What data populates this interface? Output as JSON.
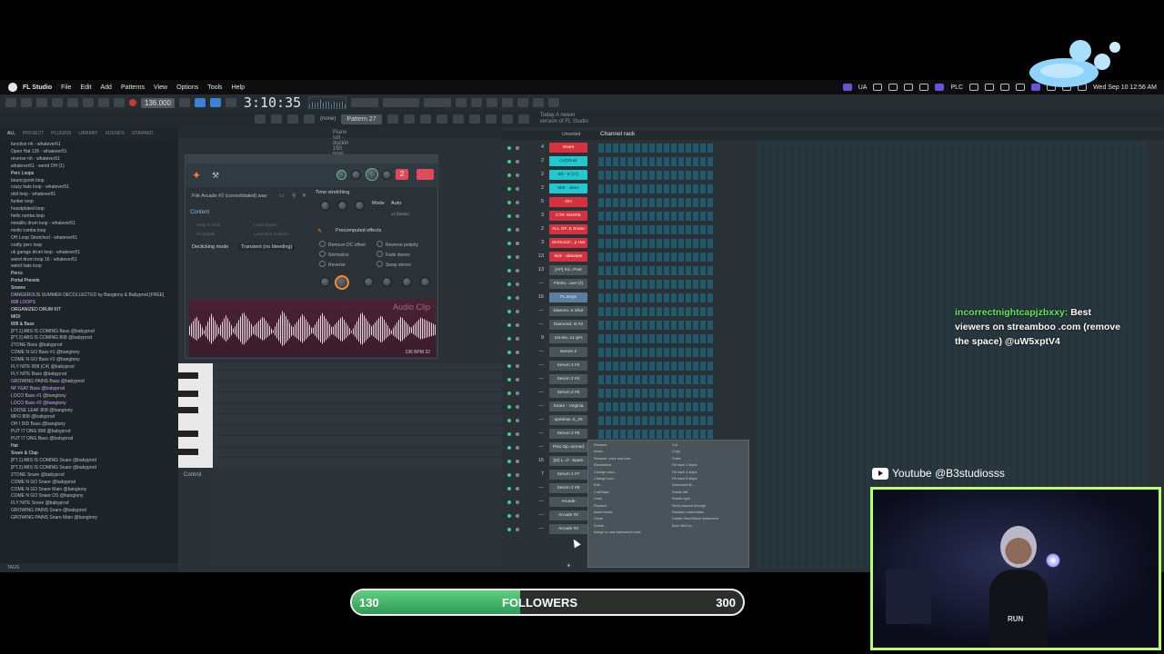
{
  "menubar": {
    "app_name": "FL Studio",
    "items": [
      "File",
      "Edit",
      "Add",
      "Patterns",
      "View",
      "Options",
      "Tools",
      "Help"
    ],
    "status_text_1": "UA",
    "status_text_2": "PLC",
    "datetime": "Wed Sep 10  12:56 AM"
  },
  "toolbar": {
    "bpm": "136.000",
    "song_time": "3:10:35",
    "pattern": "Pattern 27",
    "preset": "(none)",
    "hint_line1": "Today  A newer",
    "hint_line2": "version of FL Studio"
  },
  "browser": {
    "tabs": [
      "ALL",
      "PROJECT",
      "PLUGINS",
      "LIBRARY",
      "SOUNDS",
      "STARRED"
    ],
    "items": [
      "function nh - whatever51",
      "Open Hat 126 - whatever51",
      "reverse nh - whatever51",
      "whatever51 - weird OH (1)",
      "Perc Loops",
      "bouncypork loop",
      "crazy hats loop - whatever51",
      "dolt loop - whatever51",
      "funker loop",
      "hoastplated loop",
      "hello rumba loop",
      "metallic drum loop - whatever51",
      "mello rumba loop",
      "OH Loop Stretched - whatever51",
      "crafty perc loop",
      "uk garage drum loop - whatever51",
      "weird drum loop 16 - whatever51",
      "weird hats loop",
      "Percs",
      "Portal Presets",
      "Snares",
      "DANGEROUS SUMMER DECOLLECTED by Bangtony & Babyprod [FREE]",
      "808 LOOPS",
      "ORGANIZED DRUM KIT",
      "MIDI",
      "808 & Bass",
      "[PT.1] ABS IS COMING Bass @babyprod",
      "[PT.2] ABS IS COMING 808 @babyprod",
      "2TONE Bass @babyprod",
      "COME N GO Bass #1 @bangtony",
      "COME N GO Bass #2 @bangtony",
      "FLY NITE 808 (C4) @babyprod",
      "FLY NITE Bass @babyprod",
      "GROWING PAINS Bass @babyprod",
      "IM YEAT Bass @babyprod",
      "LOCO Bass #1 @bangtony",
      "LOCO Bass #2 @bangtony",
      "LOOSE LEAF 808 @bangtony",
      "MFO 808 @babyprod",
      "OH I DID Bass @bangtony",
      "PUT IT ONG 808 @babyprod",
      "PUT IT ONG Bass @babyprod",
      "Hat",
      "Snare & Clap",
      "[PT.1] ABS IS COMING Snare @babyprod",
      "[PT.2] ABS IS COMING Snare @babyprod",
      "2TONE Snare @babyprod",
      "COME N GO Snare @babyprod",
      "COME N GO Snare Main @bangtony",
      "COME N GO Snare OS @bangtony",
      "FLY NITE Snare @babyprod",
      "GROWING PAINS Snare @babyprod",
      "GROWING PAINS Snare Main @bangtony"
    ],
    "footer": "TAGS"
  },
  "playlist": {
    "header": "Piano roll - duckin 150 bpm @8 min @stevo",
    "control_label": "Control"
  },
  "audio_clip": {
    "file": "File  Arcade #2 (consolidated).wav",
    "counter": "2",
    "content_label": "Content",
    "content_opts": [
      "Keep on disk",
      "Resample",
      "Load regions",
      "Load slice markers"
    ],
    "declick_label": "Declicking mode",
    "declick_value": "Transient (no bleeding)",
    "time_stretching": "Time stretching",
    "mode_label": "Mode",
    "mode_value": "Auto",
    "beats": "x3 (beats)",
    "precomputed": "Precomputed effects",
    "effects_left": [
      "Remove DC offset",
      "Normalize",
      "Reverse"
    ],
    "effects_right": [
      "Reverse polarity",
      "Fade stereo",
      "Swap stereo"
    ],
    "wave_label": "Audio Clip",
    "wave_bpm": "136 BPM 32"
  },
  "channel_rack": {
    "unsorted": "Unsorted",
    "title": "Channel rack",
    "channels": [
      {
        "num": "4",
        "name": "Snare",
        "color": "red"
      },
      {
        "num": "2",
        "name": "(AZ)Drak",
        "color": "cyan"
      },
      {
        "num": "2",
        "name": "5B - 8 (27)",
        "color": "cyan"
      },
      {
        "num": "2",
        "name": "808 - Jleez",
        "color": "cyan"
      },
      {
        "num": "5",
        "name": "OH",
        "color": "red"
      },
      {
        "num": "3",
        "name": "CTR SNARE",
        "color": "red"
      },
      {
        "num": "2",
        "name": "ALL OF..E Snare",
        "color": "red"
      },
      {
        "num": "3",
        "name": "SHOULD'...p Hat",
        "color": "red"
      },
      {
        "num": "13",
        "name": "kick - absolute",
        "color": "red"
      },
      {
        "num": "13",
        "name": "[AP] Kic..Post",
        "color": "gray"
      },
      {
        "num": "---",
        "name": "Flintro...ave (2)",
        "color": "gray"
      },
      {
        "num": "16",
        "name": "FL Keys",
        "color": "blue"
      },
      {
        "num": "---",
        "name": "Diamon..e Shot",
        "color": "gray"
      },
      {
        "num": "---",
        "name": "Diamond..st #2",
        "color": "gray"
      },
      {
        "num": "9",
        "name": "1st-sto..n1-g%",
        "color": "gray"
      },
      {
        "num": "---",
        "name": "Serum 2",
        "color": "gray"
      },
      {
        "num": "---",
        "name": "Serum 2 #2",
        "color": "gray"
      },
      {
        "num": "---",
        "name": "Serum 2 #4",
        "color": "gray"
      },
      {
        "num": "---",
        "name": "Serum 2 #5",
        "color": "gray"
      },
      {
        "num": "---",
        "name": "Snare - Virginia",
        "color": "gray"
      },
      {
        "num": "---",
        "name": "openhat..rt_20",
        "color": "gray"
      },
      {
        "num": "---",
        "name": "Serum 2 #6",
        "color": "gray"
      },
      {
        "num": "---",
        "name": "Piss Op..nemed",
        "color": "gray"
      },
      {
        "num": "15",
        "name": "[IZ] L..d - Spam",
        "color": "gray"
      },
      {
        "num": "7",
        "name": "Serum 2 #7",
        "color": "gray"
      },
      {
        "num": "---",
        "name": "Serum 2 #8",
        "color": "gray"
      },
      {
        "num": "---",
        "name": "Arcade",
        "color": "gray"
      },
      {
        "num": "---",
        "name": "Arcade #2",
        "color": "gray"
      },
      {
        "num": "---",
        "name": "Arcade #3",
        "color": "gray"
      }
    ],
    "add_label": "+"
  },
  "context_menu": {
    "left": [
      "Rename",
      "Insert...",
      "Rename, color and icon...",
      "Randomize",
      "Change color...",
      "Change icon...",
      "Edit...",
      "Cut/Paste",
      "Lines",
      "Replace",
      "Insert below",
      "Clone",
      "Delete...",
      "Assign to new instrument track"
    ],
    "right": [
      "Cut",
      "Copy",
      "Paste",
      "Fill each 2 steps",
      "Fill each 4 steps",
      "Fill each 8 steps",
      "Advanced fill...",
      "Rotate left",
      "Rotate right",
      "Send channel through",
      "Random notes/notes",
      "Create DirectWave instrument",
      "Burn MIDI to..."
    ]
  },
  "overlay": {
    "chat_user": "incorrectnightcapjzbxxy:",
    "chat_text": "Best viewers on streamboo .com (remove the space) @uW5xptV4",
    "youtube": "Youtube @B3studiosss",
    "cam_shirt": "RUN",
    "followers_current": "130",
    "followers_label": "FOLLOWERS",
    "followers_goal": "300",
    "followers_progress": 0.43
  },
  "colors": {
    "accent_green": "#3fd176",
    "red_channel": "#d5313f",
    "cyan_channel": "#23c8ce",
    "webcam_border": "#b9ff6b"
  }
}
